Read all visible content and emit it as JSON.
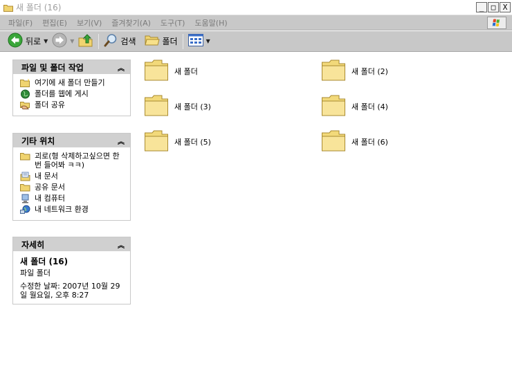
{
  "window": {
    "title": "새 폴더 (16)",
    "controls": {
      "minimize": "_",
      "maximize": "□",
      "close": "X"
    }
  },
  "menubar": {
    "items": [
      "파일(F)",
      "편집(E)",
      "보기(V)",
      "즐겨찾기(A)",
      "도구(T)",
      "도움말(H)"
    ]
  },
  "toolbar": {
    "back_label": "뒤로",
    "search_label": "검색",
    "folders_label": "폴더"
  },
  "panels": {
    "tasks": {
      "title": "파일 및 폴더 작업",
      "items": [
        "여기에 새 폴더 만들기",
        "폴더를 웹에 게시",
        "폴더 공유"
      ]
    },
    "places": {
      "title": "기타 위치",
      "items": [
        "괴로(형 삭제하고싶으면 한번 들어봐 ㅋㅋ)",
        "내 문서",
        "공유 문서",
        "내 컴퓨터",
        "내 네트워크 환경"
      ]
    },
    "details": {
      "title": "자세히",
      "name": "새 폴더 (16)",
      "type": "파일 폴더",
      "modified": "수정한 날짜: 2007년 10월 29일 월요일, 오후 8:27"
    }
  },
  "folders": [
    "새 폴더",
    "새 폴더 (2)",
    "새 폴더 (3)",
    "새 폴더 (4)",
    "새 폴더 (5)",
    "새 폴더 (6)"
  ],
  "colors": {
    "folder": "#f0d470",
    "back_green": "#3aa63a",
    "panel_header": "#d0d0d0"
  }
}
